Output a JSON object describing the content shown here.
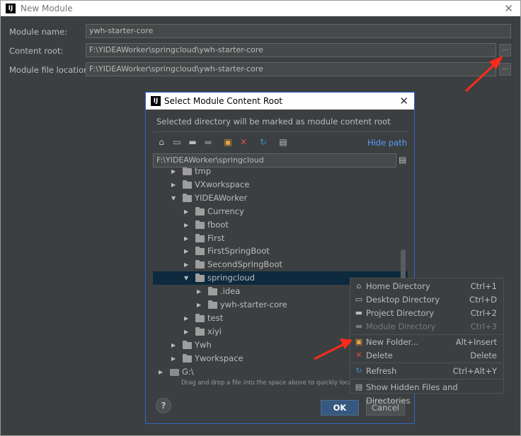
{
  "window": {
    "title": "New Module",
    "close_glyph": "✕"
  },
  "form": {
    "module_name_label": "Module name:",
    "module_name_value": "ywh-starter-core",
    "content_root_label": "Content root:",
    "content_root_value": "F:\\YIDEAWorker\\springcloud\\ywh-starter-core",
    "module_file_location_label": "Module file location:",
    "module_file_location_value": "F:\\YIDEAWorker\\springcloud\\ywh-starter-core",
    "browse_label": "..."
  },
  "dialog": {
    "title": "Select Module Content Root",
    "close_glyph": "✕",
    "description": "Selected directory will be marked as module content root",
    "hide_path_label": "Hide path",
    "path_value": "F:\\YIDEAWorker\\springcloud",
    "toolbar_icons": [
      "home-icon",
      "desktop-icon",
      "project-icon",
      "module-icon",
      "new-folder-icon",
      "delete-icon",
      "refresh-icon",
      "show-hidden-icon"
    ],
    "tree": [
      {
        "label": "tmp",
        "arrow": "▶",
        "type": "folder"
      },
      {
        "label": "VXworkspace",
        "arrow": "▶",
        "type": "folder"
      },
      {
        "label": "YIDEAWorker",
        "arrow": "▼",
        "type": "folder"
      },
      {
        "label": "Currency",
        "arrow": "▶",
        "type": "folder"
      },
      {
        "label": "fboot",
        "arrow": "▶",
        "type": "folder"
      },
      {
        "label": "First",
        "arrow": "▶",
        "type": "folder"
      },
      {
        "label": "FirstSpringBoot",
        "arrow": "▶",
        "type": "folder"
      },
      {
        "label": "SecondSpringBoot",
        "arrow": "▶",
        "type": "folder"
      },
      {
        "label": "springcloud",
        "arrow": "▼",
        "type": "folder",
        "selected": true
      },
      {
        "label": ".idea",
        "arrow": "▶",
        "type": "folder"
      },
      {
        "label": "ywh-starter-core",
        "arrow": "▶",
        "type": "folder"
      },
      {
        "label": "test",
        "arrow": "▶",
        "type": "folder"
      },
      {
        "label": "xiyi",
        "arrow": "▶",
        "type": "folder"
      },
      {
        "label": "Ywh",
        "arrow": "▶",
        "type": "folder"
      },
      {
        "label": "Yworkspace",
        "arrow": "▶",
        "type": "folder"
      },
      {
        "label": "G:\\",
        "arrow": "▶",
        "type": "drive"
      }
    ],
    "drag_hint": "Drag and drop a file into the space above to quickly locate it",
    "help_label": "?",
    "ok_label": "OK",
    "cancel_label": "Cancel"
  },
  "context_menu": {
    "items": [
      {
        "label": "Home Directory",
        "shortcut": "Ctrl+1",
        "icon": "home-icon",
        "glyph": "⌂"
      },
      {
        "label": "Desktop Directory",
        "shortcut": "Ctrl+D",
        "icon": "desktop-icon",
        "glyph": "▭"
      },
      {
        "label": "Project Directory",
        "shortcut": "Ctrl+2",
        "icon": "project-icon",
        "glyph": "▬"
      },
      {
        "label": "Module Directory",
        "shortcut": "Ctrl+3",
        "icon": "module-icon",
        "glyph": "▬",
        "disabled": true
      },
      {
        "label": "New Folder...",
        "shortcut": "Alt+Insert",
        "icon": "new-folder-icon",
        "glyph": "▣"
      },
      {
        "label": "Delete",
        "shortcut": "Delete",
        "icon": "delete-icon",
        "glyph": "✕"
      },
      {
        "label": "Refresh",
        "shortcut": "Ctrl+Alt+Y",
        "icon": "refresh-icon",
        "glyph": "↻"
      },
      {
        "label": "Show Hidden Files and Directories",
        "shortcut": "",
        "icon": "show-hidden-icon",
        "glyph": "▤"
      }
    ]
  },
  "colors": {
    "background": "#3c3f41",
    "link": "#589df6",
    "selection": "#0d293e",
    "annotation_arrow": "#ff2a1a",
    "delete_red": "#e04a3f",
    "accent_blue": "#3592c4",
    "new_folder_orange": "#e8a33d"
  }
}
